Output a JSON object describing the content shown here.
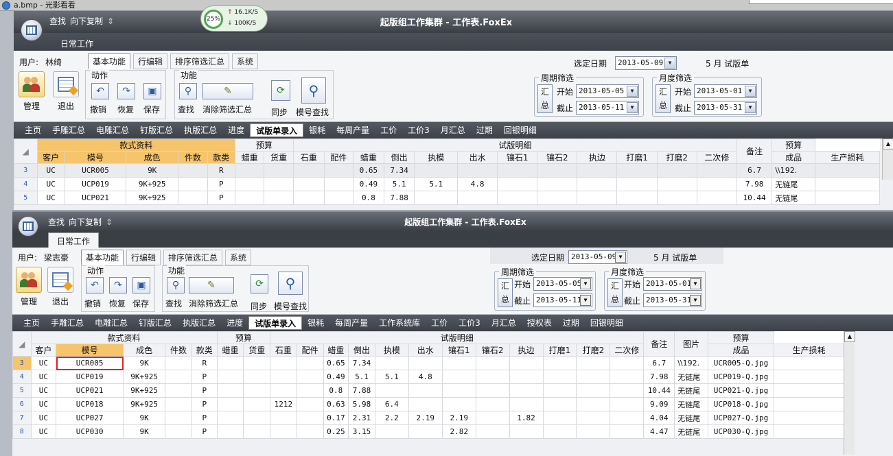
{
  "viewer": {
    "title": "a.bmp - 光影看看"
  },
  "speed": {
    "percent": "25%",
    "upload": "16.1K/S",
    "download": "100K/S"
  },
  "win1": {
    "qat": {
      "find": "查找",
      "copy_down": "向下复制",
      "dropdown": "⇕"
    },
    "title": "起版组工作集群 - 工作表.FoxEx",
    "daily_tab": "日常工作",
    "user_label": "用户:",
    "user_name": "林绮",
    "ribbon_tabs": [
      "基本功能",
      "行编辑",
      "排序筛选汇总",
      "系统"
    ],
    "manage": "管理",
    "exit": "退出",
    "action_group": "动作",
    "undo": "撤销",
    "redo": "恢复",
    "save": "保存",
    "function_group": "功能",
    "find": "查找",
    "clear_filter": "消除筛选汇总",
    "sync": "同步",
    "model_find": "模号查找",
    "date_label": "选定日期",
    "date_value": "2013-05-09",
    "month_text": "5 月 试版单",
    "week_group": "周期筛选",
    "month_group": "月度筛选",
    "summary": "汇总",
    "start": "开始",
    "end": "截止",
    "week_start": "2013-05-05",
    "week_end": "2013-05-11",
    "month_start": "2013-05-01",
    "month_end": "2013-05-31",
    "nav": [
      "主页",
      "手雕汇总",
      "电雕汇总",
      "钉版汇总",
      "执版汇总",
      "进度",
      "试版单录入",
      "银耗",
      "每周产量",
      "工价",
      "工价3",
      "月汇总",
      "过期",
      "回银明细"
    ],
    "nav_active": 6,
    "headers_top": [
      "款式资料",
      "预算",
      "试版明细",
      "备注",
      "预算"
    ],
    "headers": [
      "客户",
      "模号",
      "成色",
      "件数",
      "款类",
      "蜡重",
      "货重",
      "石重",
      "配件",
      "蜡重",
      "倒出",
      "执模",
      "出水",
      "镶石1",
      "镶石2",
      "执边",
      "打磨1",
      "打磨2",
      "二次修",
      "成品",
      "生产损耗"
    ],
    "rows": [
      {
        "no": "3",
        "c": [
          "UC",
          "UCR005",
          "9K",
          "",
          "R",
          "",
          "",
          "",
          "",
          "0.65",
          "7.34",
          "",
          "",
          "",
          "",
          "",
          "",
          "",
          "",
          "6.7",
          "\\\\192.",
          ""
        ]
      },
      {
        "no": "4",
        "c": [
          "UC",
          "UCP019",
          "9K+925",
          "",
          "P",
          "",
          "",
          "",
          "",
          "0.49",
          "5.1",
          "5.1",
          "4.8",
          "",
          "",
          "",
          "",
          "",
          "",
          "7.98",
          "无链尾",
          ""
        ]
      },
      {
        "no": "5",
        "c": [
          "UC",
          "UCP021",
          "9K+925",
          "",
          "P",
          "",
          "",
          "",
          "",
          "0.8",
          "7.88",
          "",
          "",
          "",
          "",
          "",
          "",
          "",
          "",
          "10.44",
          "无链尾",
          ""
        ]
      }
    ]
  },
  "win2": {
    "qat": {
      "find": "查找",
      "copy_down": "向下复制",
      "dropdown": "⇕"
    },
    "title": "起版组工作集群 - 工作表.FoxEx",
    "daily_tab": "日常工作",
    "user_label": "用户:",
    "user_name": "梁志豪",
    "ribbon_tabs": [
      "基本功能",
      "行编辑",
      "排序筛选汇总",
      "系统"
    ],
    "manage": "管理",
    "exit": "退出",
    "action_group": "动作",
    "undo": "撤销",
    "redo": "恢复",
    "save": "保存",
    "function_group": "功能",
    "find": "查找",
    "clear_filter": "消除筛选汇总",
    "sync": "同步",
    "model_find": "模号查找",
    "date_label": "选定日期",
    "date_value": "2013-05-09",
    "month_text": "5 月 试版单",
    "week_group": "周期筛选",
    "month_group": "月度筛选",
    "summary": "汇总",
    "start": "开始",
    "end": "截止",
    "week_start": "2013-05-05",
    "week_end": "2013-05-11",
    "month_start": "2013-05-01",
    "month_end": "2013-05-31",
    "nav": [
      "主页",
      "手雕汇总",
      "电雕汇总",
      "钉版汇总",
      "执版汇总",
      "进度",
      "试版单录入",
      "银耗",
      "每周产量",
      "工作系统库",
      "工价",
      "工价3",
      "月汇总",
      "授权表",
      "过期",
      "回银明细"
    ],
    "nav_active": 6,
    "headers_top": [
      "款式资料",
      "预算",
      "试版明细",
      "备注",
      "图片",
      "预算"
    ],
    "headers": [
      "客户",
      "模号",
      "成色",
      "件数",
      "款类",
      "蜡重",
      "货重",
      "石重",
      "配件",
      "蜡重",
      "倒出",
      "执模",
      "出水",
      "镶石1",
      "镶石2",
      "执边",
      "打磨1",
      "打磨2",
      "二次修",
      "成品",
      "生产损耗"
    ],
    "rows": [
      {
        "no": "3",
        "c": [
          "UC",
          "UCR005",
          "9K",
          "",
          "R",
          "",
          "",
          "",
          "",
          "0.65",
          "7.34",
          "",
          "",
          "",
          "",
          "",
          "",
          "",
          "",
          "6.7",
          "\\\\192.",
          "UCR005-Q.jpg",
          ""
        ]
      },
      {
        "no": "4",
        "c": [
          "UC",
          "UCP019",
          "9K+925",
          "",
          "P",
          "",
          "",
          "",
          "",
          "0.49",
          "5.1",
          "5.1",
          "4.8",
          "",
          "",
          "",
          "",
          "",
          "",
          "7.98",
          "无链尾",
          "UCP019-Q.jpg",
          ""
        ]
      },
      {
        "no": "5",
        "c": [
          "UC",
          "UCP021",
          "9K+925",
          "",
          "P",
          "",
          "",
          "",
          "",
          "0.8",
          "7.88",
          "",
          "",
          "",
          "",
          "",
          "",
          "",
          "",
          "10.44",
          "无链尾",
          "UCP021-Q.jpg",
          ""
        ]
      },
      {
        "no": "6",
        "c": [
          "UC",
          "UCP018",
          "9K+925",
          "",
          "P",
          "",
          "",
          "1212",
          "",
          "0.63",
          "5.98",
          "6.4",
          "",
          "",
          "",
          "",
          "",
          "",
          "",
          "9.09",
          "无链尾",
          "UCP018-Q.jpg",
          ""
        ]
      },
      {
        "no": "7",
        "c": [
          "UC",
          "UCP027",
          "9K",
          "",
          "P",
          "",
          "",
          "",
          "",
          "0.17",
          "2.31",
          "2.2",
          "2.19",
          "2.19",
          "",
          "1.82",
          "",
          "",
          "",
          "4.04",
          "无链尾",
          "UCP027-Q.jpg",
          ""
        ]
      },
      {
        "no": "8",
        "c": [
          "UC",
          "UCP030",
          "9K",
          "",
          "P",
          "",
          "",
          "",
          "",
          "0.25",
          "3.15",
          "",
          "",
          "2.82",
          "",
          "",
          "",
          "",
          "",
          "4.47",
          "无链尾",
          "UCP030-Q.jpg",
          ""
        ]
      }
    ]
  }
}
